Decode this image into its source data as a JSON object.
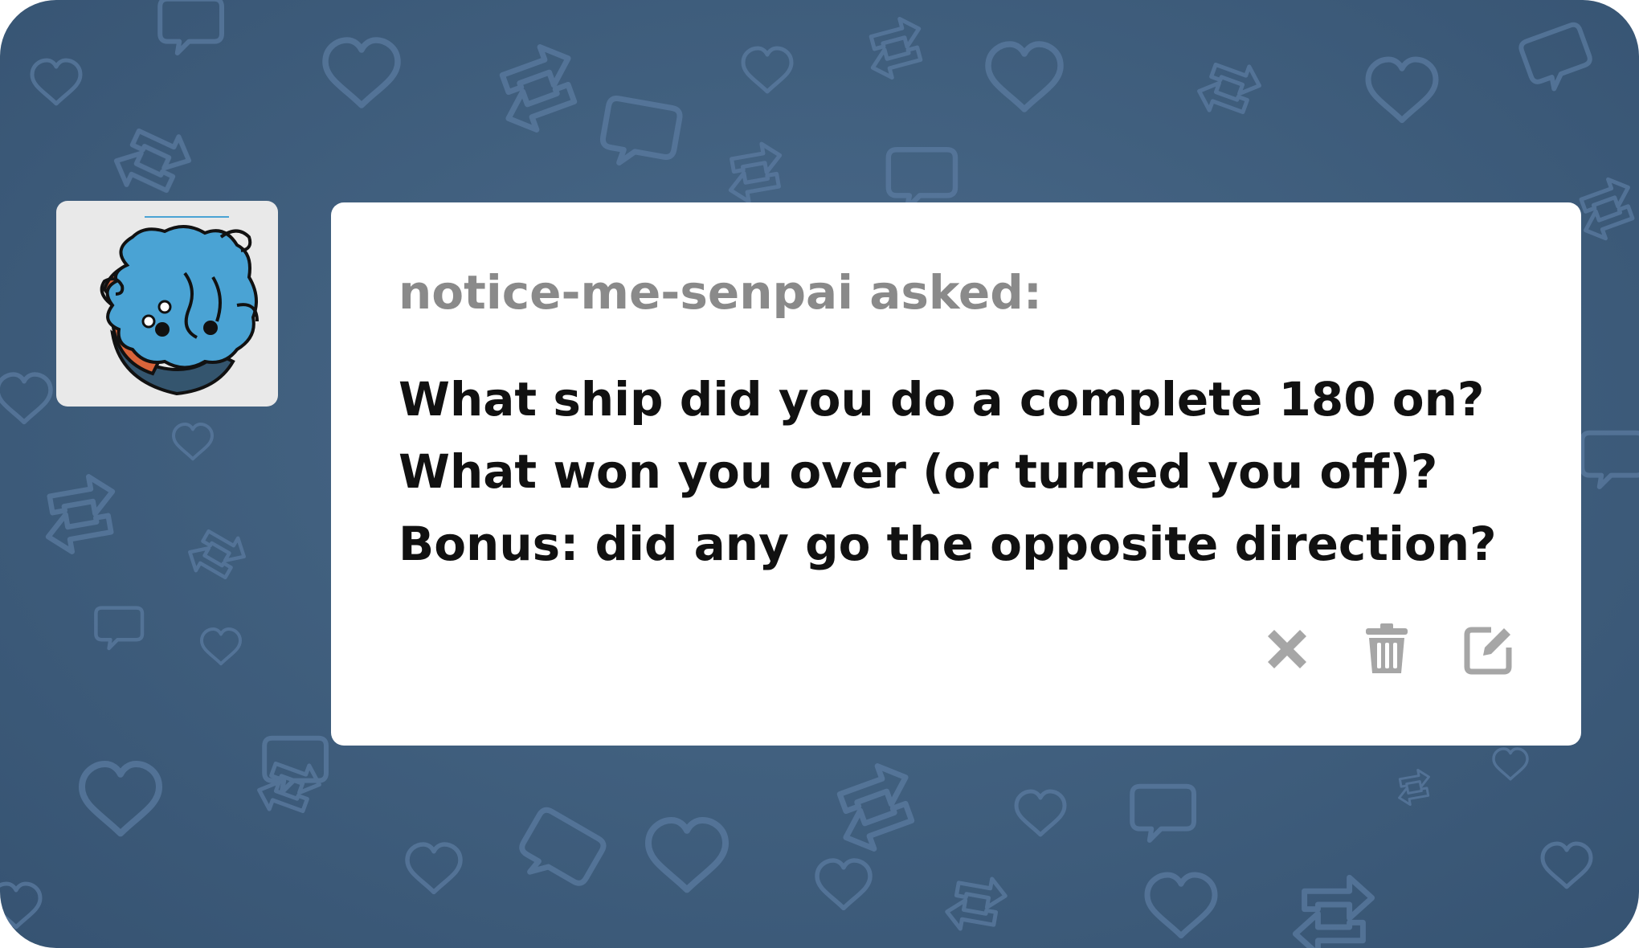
{
  "ask": {
    "asker_line": "notice-me-senpai asked:",
    "question_lines": [
      "What ship did you do a complete 180 on?",
      "What won you over (or turned you off)?",
      "Bonus: did any go the opposite direction?"
    ]
  },
  "actions": [
    {
      "icon": "close-icon",
      "label": "delete"
    },
    {
      "icon": "trash-icon",
      "label": "trash"
    },
    {
      "icon": "edit-icon",
      "label": "edit"
    }
  ],
  "colors": {
    "background": "#41607f",
    "card": "#ffffff",
    "asker_text": "#8a8a8a",
    "question_text": "#111111",
    "icon": "#a6a6a6",
    "avatar_blue": "#4aa3d4",
    "avatar_orange": "#d9643a"
  }
}
